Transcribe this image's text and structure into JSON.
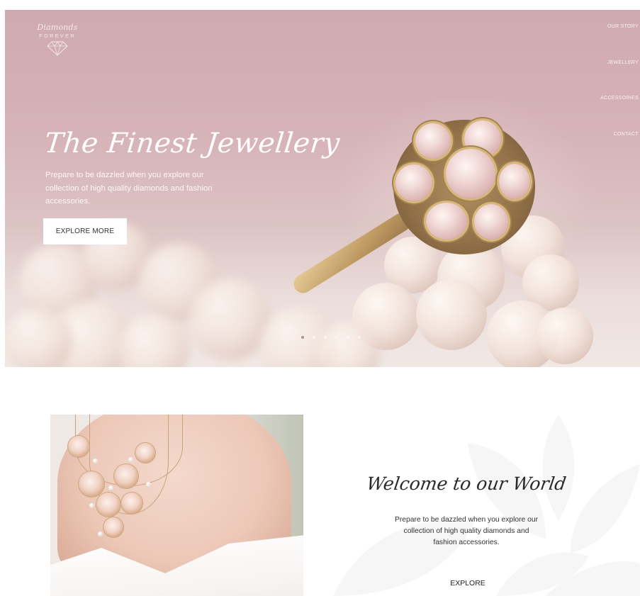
{
  "brand": {
    "script": "Diamonds",
    "caps": "FOREVER",
    "icon": "diamond-outline-icon"
  },
  "nav": {
    "items": [
      {
        "label": "OUR STORY"
      },
      {
        "label": "JEWELLERY"
      },
      {
        "label": "ACCESSORIES"
      },
      {
        "label": "CONTACT"
      }
    ]
  },
  "hero": {
    "title": "The Finest Jewellery",
    "text": "Prepare to be dazzled when you explore our collection of high quality diamonds and fashion accessories.",
    "button_label": "EXPLORE MORE",
    "slides_total": 6,
    "active_slide": 1
  },
  "welcome": {
    "title": "Welcome to our World",
    "text": "Prepare to be dazzled when you explore our collection of high quality diamonds and fashion accessories.",
    "button_label": "EXPLORE"
  },
  "colors": {
    "hero_pink": "#d3b0b6",
    "text_dark": "#2a2a2a",
    "white": "#ffffff"
  }
}
